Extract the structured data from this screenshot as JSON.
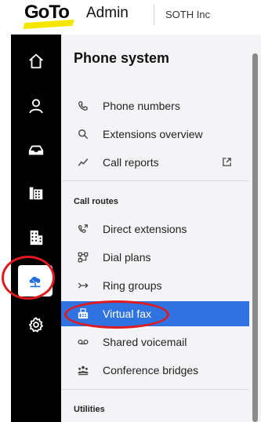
{
  "header": {
    "logo_text": "GoTo",
    "app_name": "Admin",
    "org_name": "SOTH Inc"
  },
  "rail": {
    "items": [
      {
        "icon": "home-icon"
      },
      {
        "icon": "user-icon"
      },
      {
        "icon": "inbox-icon"
      },
      {
        "icon": "building-icon"
      },
      {
        "icon": "office-icon"
      },
      {
        "icon": "cloud-phone-icon",
        "active": true
      },
      {
        "icon": "gear-icon"
      }
    ]
  },
  "panel": {
    "title": "Phone system",
    "top_items": [
      {
        "label": "Phone numbers",
        "icon": "phone-icon"
      },
      {
        "label": "Extensions overview",
        "icon": "search-icon"
      },
      {
        "label": "Call reports",
        "icon": "chart-icon",
        "external": true
      }
    ],
    "call_routes_label": "Call routes",
    "call_routes": [
      {
        "label": "Direct extensions",
        "icon": "phone-forward-icon"
      },
      {
        "label": "Dial plans",
        "icon": "flow-icon"
      },
      {
        "label": "Ring groups",
        "icon": "ring-group-icon"
      },
      {
        "label": "Virtual fax",
        "icon": "fax-icon",
        "selected": true
      },
      {
        "label": "Shared voicemail",
        "icon": "voicemail-icon"
      },
      {
        "label": "Conference bridges",
        "icon": "people-icon"
      }
    ],
    "utilities_label": "Utilities"
  },
  "colors": {
    "rail_bg": "#000000",
    "panel_bg": "#f4f4f6",
    "selected_bg": "#2f73e0",
    "accent_icon": "#1f6fe0",
    "annotation": "#e0191f",
    "logo_highlight": "#f5e600"
  }
}
